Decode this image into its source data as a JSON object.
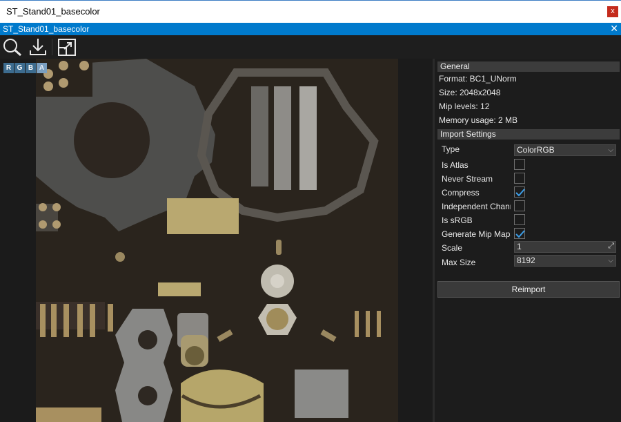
{
  "window": {
    "title": "ST_Stand01_basecolor",
    "close_label": "x"
  },
  "tab": {
    "title": "ST_Stand01_basecolor",
    "close_label": "✕"
  },
  "toolbar": {
    "icons": [
      "search-icon",
      "download-icon",
      "resize-icon"
    ]
  },
  "channels": [
    "R",
    "G",
    "B",
    "A"
  ],
  "general": {
    "header": "General",
    "format": "Format: BC1_UNorm",
    "size": "Size: 2048x2048",
    "mip_levels": "Mip levels: 12",
    "memory": "Memory usage: 2 MB"
  },
  "import_settings": {
    "header": "Import Settings",
    "type_label": "Type",
    "type_value": "ColorRGB",
    "is_atlas_label": "Is Atlas",
    "is_atlas": false,
    "never_stream_label": "Never Stream",
    "never_stream": false,
    "compress_label": "Compress",
    "compress": true,
    "independent_label": "Independent Chann",
    "independent": false,
    "is_srgb_label": "Is sRGB",
    "is_srgb": false,
    "gen_mips_label": "Generate Mip Maps",
    "gen_mips": true,
    "scale_label": "Scale",
    "scale_value": "1",
    "max_size_label": "Max Size",
    "max_size_value": "8192"
  },
  "reimport_label": "Reimport",
  "colors": {
    "accent": "#007acc",
    "check": "#3c9ee8"
  }
}
